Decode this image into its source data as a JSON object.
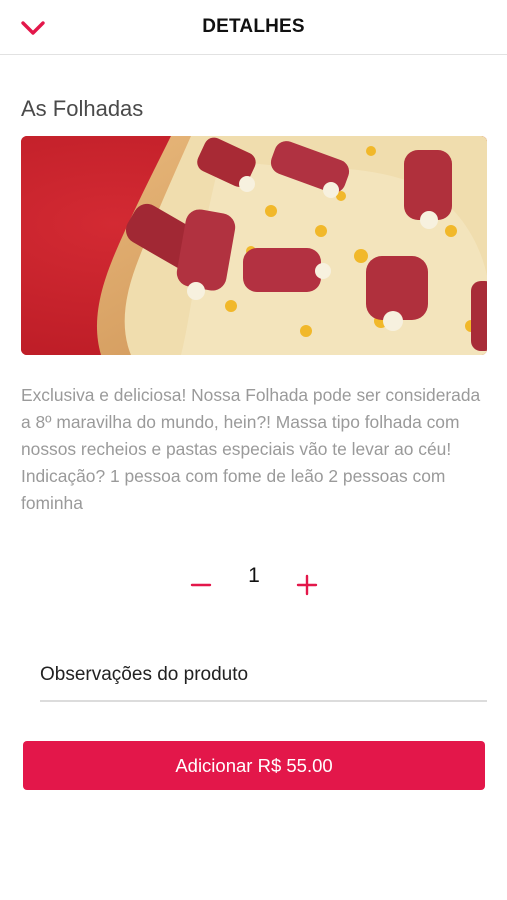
{
  "header": {
    "title": "DETALHES",
    "back_icon": "chevron-down-icon"
  },
  "product": {
    "title": "As Folhadas",
    "image": "pizza-photo",
    "description": "Exclusiva e deliciosa! Nossa Folhada pode ser considerada a 8º maravilha do mundo, hein?! Massa tipo folhada com nossos recheios e pastas especiais vão te levar ao céu!  Indicação? 1 pessoa com fome de leão 2 pessoas com fominha"
  },
  "quantity": {
    "value": "1",
    "minus_icon": "minus-icon",
    "plus_icon": "plus-icon"
  },
  "notes": {
    "placeholder": "Observações do produto"
  },
  "cta": {
    "label": "Adicionar R$ 55.00"
  },
  "colors": {
    "accent": "#e3174a",
    "text_muted": "#9a9a9a"
  }
}
